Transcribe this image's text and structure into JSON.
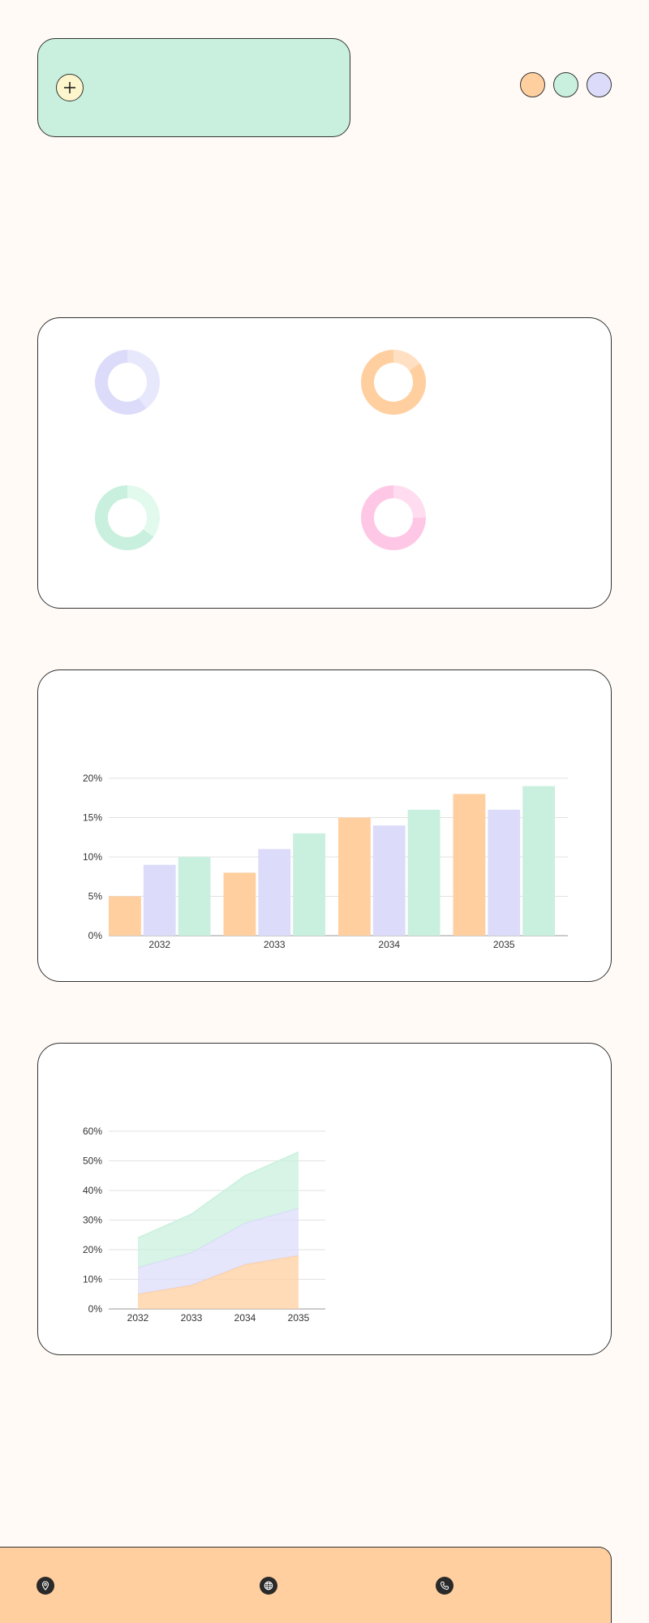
{
  "colors": {
    "orange": "#ffcfa0",
    "mint": "#c9f0de",
    "lavender": "#dcdcfa",
    "pink": "#ffc7e6",
    "yellow": "#fdf6cc"
  },
  "header": {
    "add_icon": "plus-icon",
    "swatches": [
      {
        "name": "orange",
        "color": "#ffcfa0"
      },
      {
        "name": "mint",
        "color": "#c9f0de"
      },
      {
        "name": "lavender",
        "color": "#dcdcfa"
      }
    ]
  },
  "footer": {
    "icons": [
      "location-pin-icon",
      "globe-icon",
      "phone-icon"
    ]
  },
  "chart_data": [
    {
      "type": "pie",
      "variant": "donut-grid",
      "donuts": [
        {
          "main_color": "#dcdcfa",
          "light_color": "#e8e8fc",
          "values": [
            60,
            40
          ]
        },
        {
          "main_color": "#ffcfa0",
          "light_color": "#ffe0c2",
          "values": [
            85,
            15
          ]
        },
        {
          "main_color": "#c9f0de",
          "light_color": "#e2faee",
          "values": [
            65,
            35
          ]
        },
        {
          "main_color": "#ffc7e6",
          "light_color": "#ffdcef",
          "values": [
            75,
            25
          ]
        }
      ]
    },
    {
      "type": "bar",
      "categories": [
        "2032",
        "2033",
        "2034",
        "2035"
      ],
      "series": [
        {
          "color": "#ffcfa0",
          "values": [
            5,
            8,
            15,
            18
          ]
        },
        {
          "color": "#dcdcfa",
          "values": [
            9,
            11,
            14,
            16
          ]
        },
        {
          "color": "#c9f0de",
          "values": [
            10,
            13,
            16,
            19
          ]
        }
      ],
      "ylim": [
        0,
        20
      ],
      "yticks": [
        "0%",
        "5%",
        "10%",
        "15%",
        "20%"
      ],
      "grid": true
    },
    {
      "type": "area",
      "stacked": true,
      "categories": [
        "2032",
        "2033",
        "2034",
        "2035"
      ],
      "series": [
        {
          "color": "#ffcfa0",
          "values": [
            5,
            8,
            15,
            18
          ]
        },
        {
          "color": "#dcdcfa",
          "values": [
            9,
            11,
            14,
            16
          ]
        },
        {
          "color": "#c9f0de",
          "values": [
            10,
            13,
            16,
            19
          ]
        }
      ],
      "ylim": [
        0,
        60
      ],
      "yticks": [
        "0%",
        "10%",
        "20%",
        "30%",
        "40%",
        "50%",
        "60%"
      ],
      "grid": true
    }
  ]
}
